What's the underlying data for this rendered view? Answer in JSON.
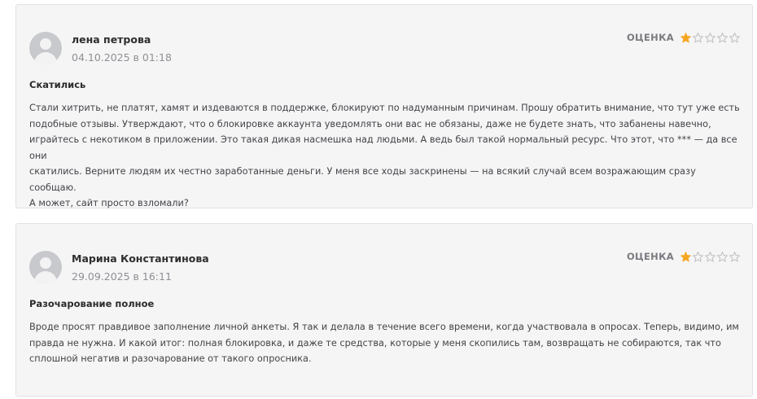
{
  "rating_label": "ОЦЕНКА",
  "colors": {
    "star_filled": "#f5a623",
    "star_empty": "#b9b9bd"
  },
  "reviews": [
    {
      "author": "лена петрова",
      "date": "04.10.2025 в 01:18",
      "rating": 1,
      "max_rating": 5,
      "title": "Скатились",
      "lines": [
        "Стали хитрить, не платят, хамят и издеваются в поддержке, блокируют по надуманным причинам. Прошу обратить внимание, что тут уже есть",
        "подобные отзывы. Утверждают, что о блокировке аккаунта уведомлять они вас не обязаны, даже не будете знать, что забанены навечно,",
        "играйтесь с некотиком в приложении. Это такая дикая насмешка над людьми. А ведь был такой нормальный ресурс. Что этот, что *** — да все они",
        "скатились. Верните людям их честно заработанные деньги. У меня все ходы заскринены — на всякий случай всем возражающим сразу сообщаю.",
        "А может, сайт просто взломали?"
      ]
    },
    {
      "author": "Марина Константинова",
      "date": "29.09.2025 в 16:11",
      "rating": 1,
      "max_rating": 5,
      "title": "Разочарование полное",
      "lines": [
        "Вроде просят правдивое заполнение личной анкеты. Я так и делала в течение всего времени, когда участвовала в опросах. Теперь, видимо, им",
        "правда не нужна. И какой итог: полная блокировка, и даже те средства, которые у меня скопились там, возвращать не собираются, так что",
        "сплошной негатив и разочарование от такого опросника."
      ]
    }
  ]
}
